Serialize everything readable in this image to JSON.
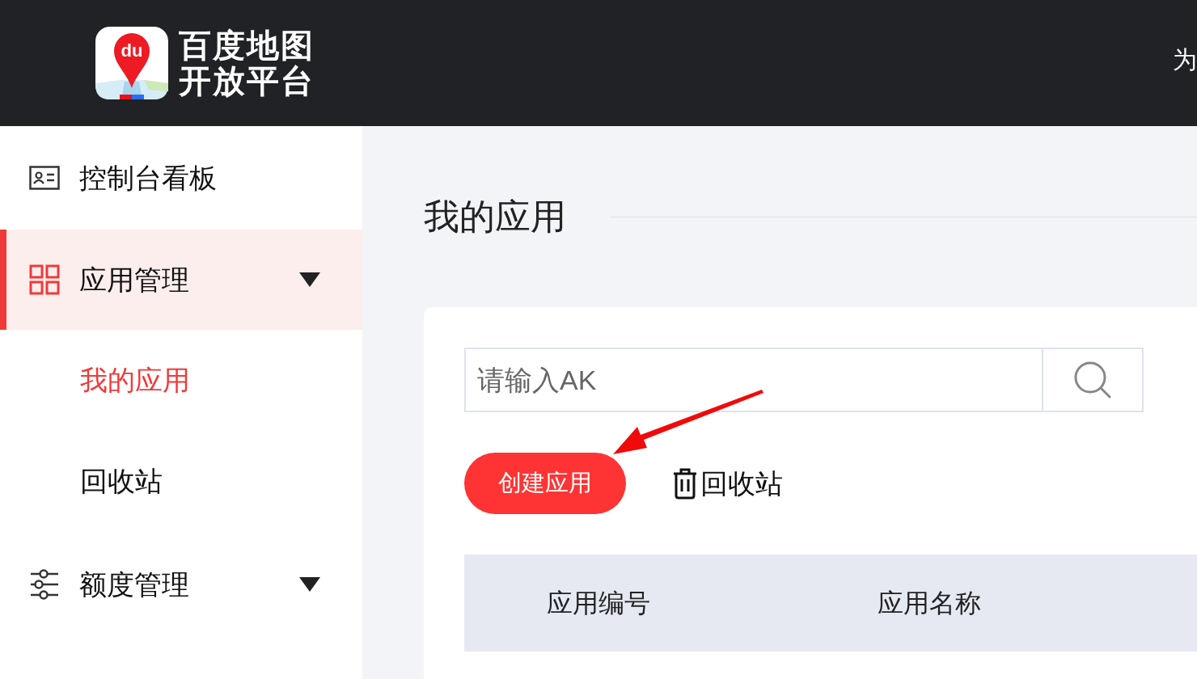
{
  "header": {
    "logo_badge": "du",
    "logo_line_1": "百度地图",
    "logo_line_2": "开放平台",
    "right_text": "为"
  },
  "sidebar": {
    "items": [
      {
        "label": "控制台看板",
        "kind": "card",
        "selected": false,
        "expandable": false
      },
      {
        "label": "应用管理",
        "kind": "grid",
        "selected": true,
        "expandable": true,
        "children": [
          {
            "label": "我的应用",
            "selected": true
          },
          {
            "label": "回收站",
            "selected": false
          }
        ]
      },
      {
        "label": "额度管理",
        "kind": "sliders",
        "selected": false,
        "expandable": true
      }
    ]
  },
  "page_title": "我的应用",
  "search": {
    "placeholder": "请输入AK"
  },
  "actions": {
    "create": "创建应用",
    "recycle": "回收站"
  },
  "table": {
    "columns": [
      "应用编号",
      "应用名称"
    ]
  }
}
